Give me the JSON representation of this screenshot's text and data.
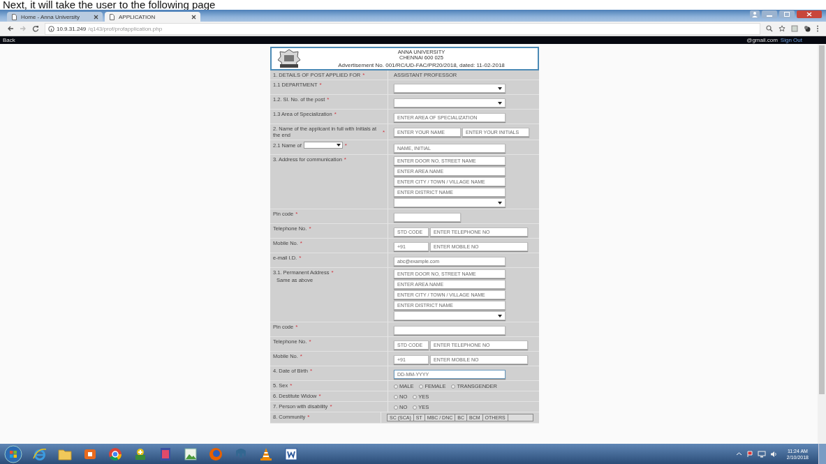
{
  "caption": "Next, it will take the user to the following page",
  "browser": {
    "tabs": [
      {
        "label": "Home - Anna University",
        "selected": false
      },
      {
        "label": "APPLICATION",
        "selected": true
      }
    ],
    "address_host": "10.9.31.249",
    "address_path": "/q143/prof/profapplication.php"
  },
  "top_bar": {
    "back": "Back",
    "user": "@gmail.com",
    "sign_out": "Sign Out"
  },
  "header": {
    "title": "ANNA UNIVERSITY",
    "city": "CHENNAI 600 025",
    "advertisement": "Advertisement No. 001/RC/UD-FAC/PR20/2018, dated: 11-02-2018"
  },
  "rows": [
    {
      "kind": "text",
      "label": "1. DETAILS OF POST APPLIED FOR",
      "mark": "*",
      "value": "ASSISTANT PROFESSOR"
    },
    {
      "kind": "fields",
      "label": "1.1 DEPARTMENT",
      "mark": "*",
      "fields": [
        {
          "kind": "select"
        }
      ]
    },
    {
      "kind": "fields",
      "label": "1.2. Sl. No. of the post",
      "mark": "*",
      "fields": [
        {
          "kind": "select"
        }
      ]
    },
    {
      "kind": "fields",
      "label": "1.3 Area of Specialization",
      "mark": "*",
      "fields": [
        {
          "kind": "input",
          "placeholder": "ENTER AREA OF SPECIALIZATION"
        }
      ]
    },
    {
      "kind": "fields",
      "label": "2. Name of the applicant in full with Initials at the end",
      "mark": "*",
      "fields": [
        {
          "kind": "half",
          "placeholder": "ENTER YOUR NAME"
        },
        {
          "kind": "half",
          "placeholder": "ENTER YOUR INITIALS"
        }
      ]
    },
    {
      "kind": "fields",
      "label": "2.1 Name of",
      "label_select": true,
      "mark": "*",
      "fields": [
        {
          "kind": "input",
          "placeholder": "NAME, INITIAL"
        }
      ]
    },
    {
      "kind": "stack",
      "label": "3. Address for communication",
      "mark": "*",
      "fields": [
        {
          "kind": "input",
          "placeholder": "ENTER DOOR NO, STREET NAME"
        },
        {
          "kind": "input",
          "placeholder": "ENTER AREA NAME"
        },
        {
          "kind": "input",
          "placeholder": "ENTER CITY / TOWN / VILLAGE NAME"
        },
        {
          "kind": "input",
          "placeholder": "ENTER DISTRICT NAME"
        },
        {
          "kind": "select"
        }
      ]
    },
    {
      "kind": "fields",
      "label": "Pin code",
      "mark": "*",
      "fields": [
        {
          "kind": "short"
        }
      ]
    },
    {
      "kind": "fields",
      "label": "Telephone No.",
      "mark": "*",
      "fields": [
        {
          "kind": "code",
          "placeholder": "STD CODE"
        },
        {
          "kind": "wide",
          "placeholder": "ENTER TELEPHONE NO"
        }
      ]
    },
    {
      "kind": "fields",
      "label": "Mobile No.",
      "mark": "*",
      "fields": [
        {
          "kind": "code",
          "placeholder": "+91"
        },
        {
          "kind": "wide",
          "placeholder": "ENTER MOBILE NO"
        }
      ]
    },
    {
      "kind": "fields",
      "label": "e-mail I.D.",
      "mark": "*",
      "fields": [
        {
          "kind": "input",
          "placeholder": "abc@example.com"
        }
      ]
    },
    {
      "kind": "stack",
      "label": "3.1. Permanent Address",
      "mark": "*",
      "sublabel": "Same as above",
      "fields": [
        {
          "kind": "input",
          "placeholder": "ENTER DOOR NO, STREET NAME"
        },
        {
          "kind": "input",
          "placeholder": "ENTER AREA NAME"
        },
        {
          "kind": "input",
          "placeholder": "ENTER CITY / TOWN / VILLAGE NAME"
        },
        {
          "kind": "input",
          "placeholder": "ENTER DISTRICT NAME"
        },
        {
          "kind": "select"
        }
      ]
    },
    {
      "kind": "fields",
      "label": "Pin code",
      "mark": "*",
      "fields": [
        {
          "kind": "input"
        }
      ]
    },
    {
      "kind": "fields",
      "label": "Telephone No.",
      "mark": "*",
      "fields": [
        {
          "kind": "code",
          "placeholder": "STD CODE"
        },
        {
          "kind": "wide",
          "placeholder": "ENTER TELEPHONE NO"
        }
      ]
    },
    {
      "kind": "fields",
      "label": "Mobile No.",
      "mark": "*",
      "fields": [
        {
          "kind": "code",
          "placeholder": "+91"
        },
        {
          "kind": "wide",
          "placeholder": "ENTER MOBILE NO"
        }
      ]
    },
    {
      "kind": "fields",
      "label": "4. Date of Birth",
      "mark": "*",
      "fields": [
        {
          "kind": "input",
          "placeholder": "DD-MM-YYYY"
        }
      ]
    },
    {
      "kind": "options",
      "label": "5. Sex",
      "mark": "*",
      "options": [
        {
          "label": "MALE",
          "selected": false
        },
        {
          "label": "FEMALE",
          "selected": false
        },
        {
          "label": "TRANSGENDER",
          "selected": false
        }
      ]
    },
    {
      "kind": "options",
      "label": "6. Destitute Widow",
      "mark": "*",
      "options": [
        {
          "label": "NO",
          "selected": false
        },
        {
          "label": "YES",
          "selected": false
        }
      ]
    },
    {
      "kind": "options",
      "label": "7. Person with disability",
      "mark": "*",
      "options": [
        {
          "label": "NO",
          "selected": false
        },
        {
          "label": "YES",
          "selected": false
        }
      ]
    },
    {
      "kind": "table",
      "label": "8. Community",
      "mark": "*",
      "cells": [
        "SC (SCA)",
        "ST",
        "MBC / DNC",
        "BC",
        "BCM",
        "OTHERS"
      ]
    }
  ],
  "clock": {
    "time": "11:24 AM",
    "date": "2/10/2018"
  }
}
